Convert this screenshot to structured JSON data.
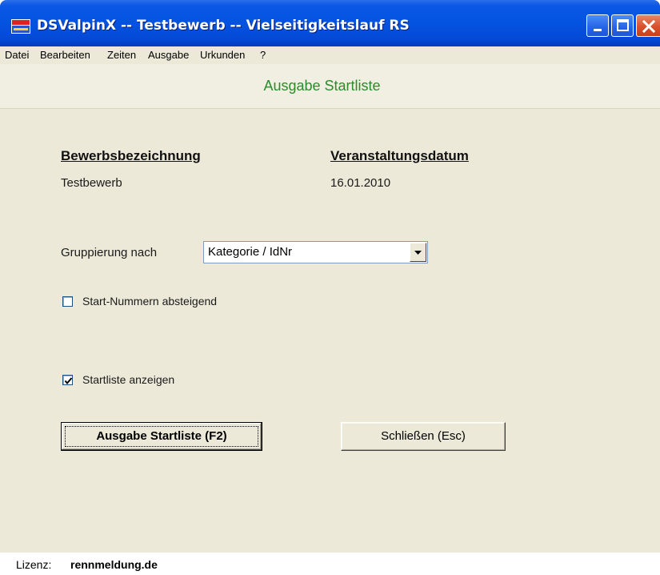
{
  "window": {
    "title": "DSValpinX -- Testbewerb -- Vielseitigkeitslauf RS",
    "icon": "app-logo-icon",
    "controls": [
      "minimize-icon",
      "maximize-icon",
      "close-icon"
    ]
  },
  "menu": [
    "Datei",
    "Bearbeiten",
    "Zeiten",
    "Ausgabe",
    "Urkunden",
    "?"
  ],
  "header": {
    "title": "Ausgabe Startliste"
  },
  "competition": {
    "name_label": "Bewerbsbezeichnung",
    "name_value": "Testbewerb",
    "date_label": "Veranstaltungsdatum",
    "date_value": "16.01.2010"
  },
  "grouping": {
    "label": "Gruppierung nach",
    "selected": "Kategorie / IdNr"
  },
  "options": {
    "descending": {
      "label": "Start-Nummern absteigend",
      "checked": false
    },
    "show_list": {
      "label": "Startliste anzeigen",
      "checked": true
    }
  },
  "buttons": {
    "output": "Ausgabe Startliste (F2)",
    "close": "Schließen (Esc)"
  },
  "status": {
    "license_label": "Lizenz:",
    "license_value": "rennmeldung.de"
  },
  "colors": {
    "titlebar": "#0453e0",
    "face": "#ece9d8",
    "header_title": "#2a8c2a",
    "close_button": "#d8512b"
  }
}
